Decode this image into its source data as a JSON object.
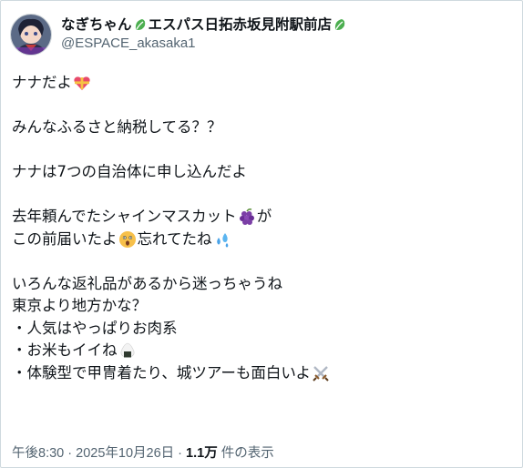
{
  "author": {
    "display_name_1": "なぎちゃん",
    "display_name_2": "エスパス日拓赤坂見附駅前店",
    "handle": "@ESPACE_akasaka1",
    "name_icon": "leaf-icon"
  },
  "tweet": {
    "l1": "ナナだよ",
    "l2": "みんなふるさと納税してる？？",
    "l3": "ナナは7つの自治体に申し込んだよ",
    "l4": "去年頼んでたシャインマスカット",
    "l4b": "が",
    "l5a": "この前届いたよ",
    "l5b": "忘れてたね",
    "l6": "いろんな返礼品があるから迷っちゃうね",
    "l7": "東京より地方かな？",
    "l8": "・人気はやっぱりお肉系",
    "l9": "・お米もイイね",
    "l10": "・体験型で甲冑着たり、城ツアーも面白いよ"
  },
  "meta": {
    "time": "午後8:30",
    "sep1": " · ",
    "date": "2025年10月26日",
    "sep2": " · ",
    "views": "1.1万",
    "views_label": " 件の表示"
  },
  "colors": {
    "text": "#0f1419",
    "muted": "#536471",
    "border": "#cfd9de"
  }
}
